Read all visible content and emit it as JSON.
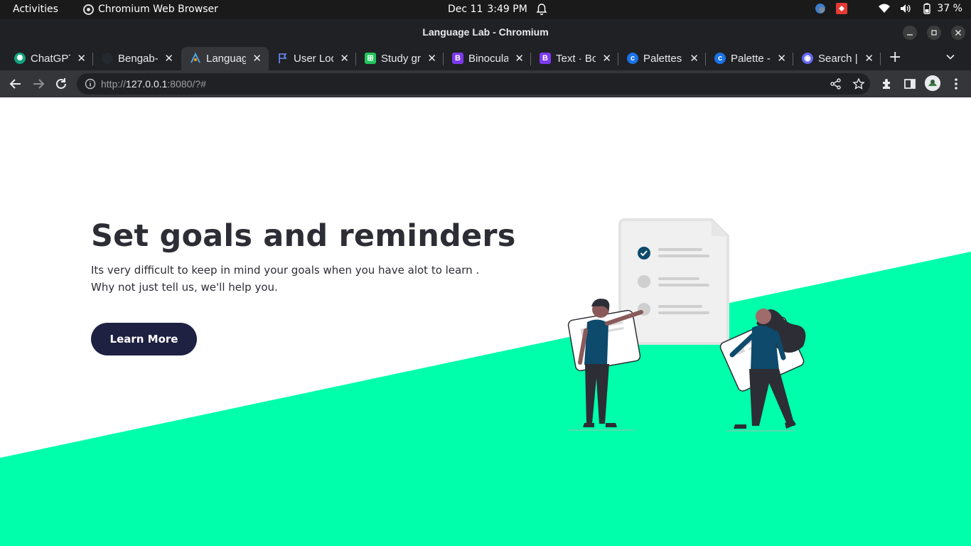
{
  "system_bar": {
    "activities": "Activities",
    "app_name": "Chromium Web Browser",
    "date": "Dec 11",
    "time": "3:49 PM",
    "battery": "37 %"
  },
  "window": {
    "title": "Language Lab - Chromium"
  },
  "tabs": [
    {
      "label": "ChatGPT",
      "icon": "chatgpt-icon",
      "color": "#10a37f"
    },
    {
      "label": "Bengab-",
      "icon": "github-icon",
      "color": "#24292f"
    },
    {
      "label": "Languag",
      "icon": "language-lab-icon",
      "color": "#4fa3e0"
    },
    {
      "label": "User Loc",
      "icon": "flag-icon",
      "color": "#4a6cf7"
    },
    {
      "label": "Study gr",
      "icon": "study-group-icon",
      "color": "#22c55e"
    },
    {
      "label": "Binocula",
      "icon": "bootstrap-icon",
      "color": "#7c3aed"
    },
    {
      "label": "Text · Bo",
      "icon": "bootstrap-icon",
      "color": "#7c3aed"
    },
    {
      "label": "Palettes",
      "icon": "coolors-icon",
      "color": "#1a73e8"
    },
    {
      "label": "Palette -",
      "icon": "coolors-icon",
      "color": "#1a73e8"
    },
    {
      "label": "Search |",
      "icon": "search-site-icon",
      "color": "#6366f1"
    }
  ],
  "toolbar": {
    "url_prefix": "http://",
    "url_host": "127.0.0.1",
    "url_rest": ":8080/?#"
  },
  "hero": {
    "title": "Set goals and reminders",
    "desc_line1": "Its very difficult to keep in mind your goals when you have alot to learn .",
    "desc_line2": "Why not just tell us, we'll help you.",
    "cta": "Learn More"
  },
  "colors": {
    "accent_green": "#00ffaa",
    "button_navy": "#1e2142",
    "text_dark": "#2d2d35"
  }
}
